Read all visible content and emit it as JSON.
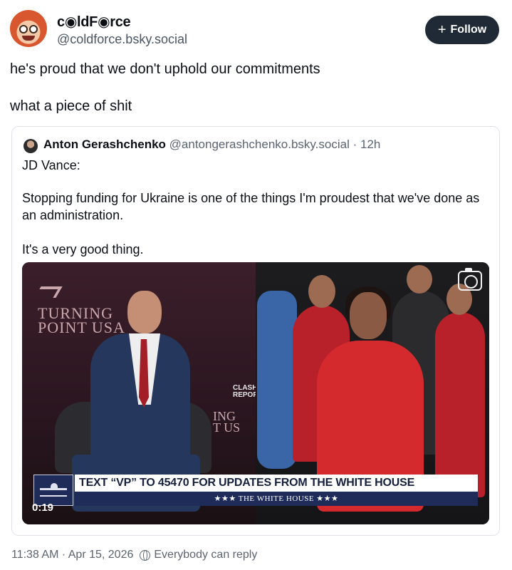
{
  "post": {
    "author": {
      "display_name": "c◉ldF◉rce",
      "handle": "@coldforce.bsky.social",
      "avatar_icon": "cartoon-avatar"
    },
    "follow_label": "Follow",
    "text_lines": [
      "he's proud that we don't uphold our commitments",
      "what a piece of shit"
    ],
    "timestamp": "11:38 AM · Apr 15, 2026",
    "reply_setting": "Everybody can reply"
  },
  "quote": {
    "author_name": "Anton Gerashchenko",
    "author_meta": "@antongerashchenko.bsky.social · 12h",
    "lines": [
      "JD Vance:",
      "Stopping funding for Ukraine is one of the things I'm proudest that we've done as an administration.",
      "It's a very good thing."
    ],
    "video": {
      "duration": "0:19",
      "stage_text_left": "TURNING POINT USA",
      "stage_text_mid": "ING T US",
      "watermark": "CLASH REPORT",
      "chyron_main": "TEXT “VP” TO 45470 FOR UPDATES FROM THE WHITE HOUSE",
      "chyron_sub": "★★★ THE WHITE HOUSE ★★★"
    }
  },
  "colors": {
    "follow_bg": "#1f2a36",
    "chyron_navy": "#1f2c5a",
    "muted_text": "#5b6470",
    "card_border": "#dfe3e8"
  }
}
